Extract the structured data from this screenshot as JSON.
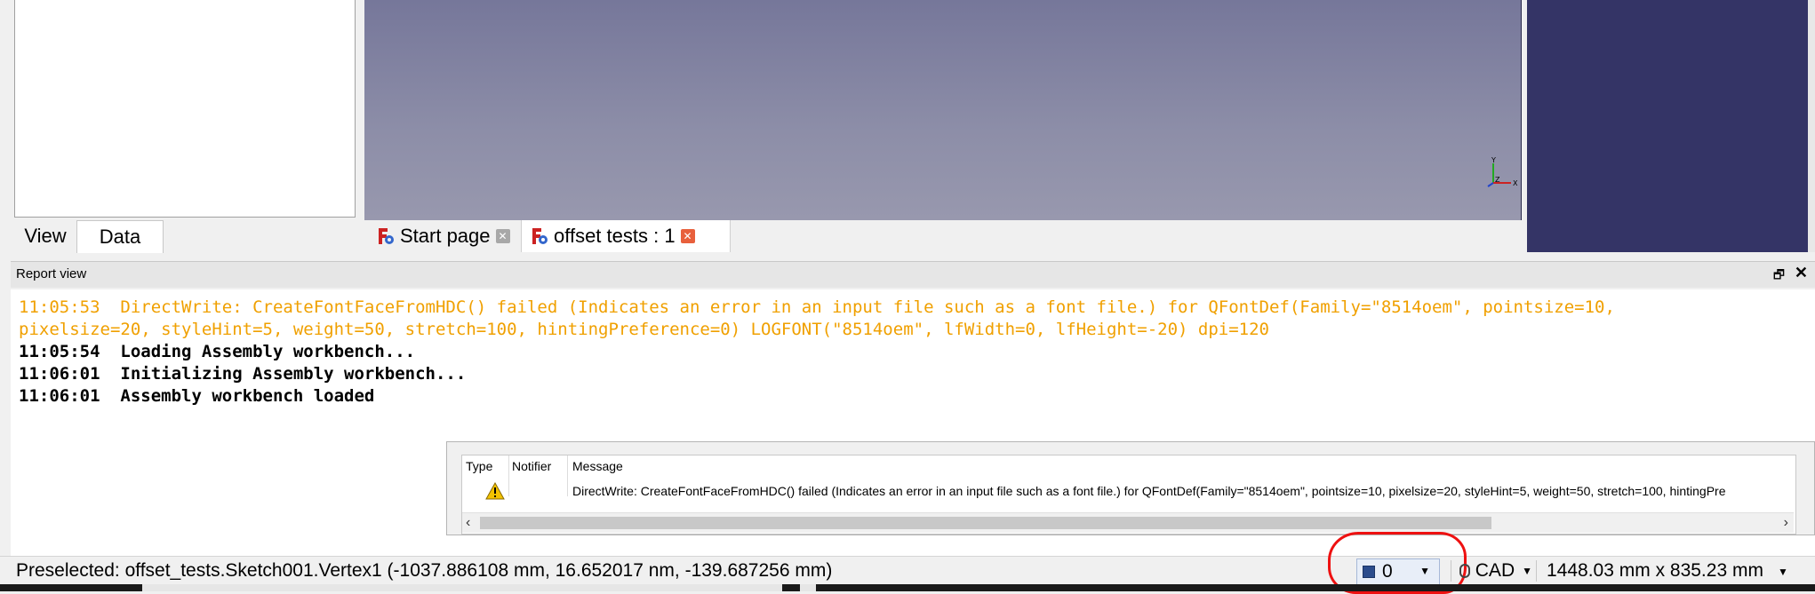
{
  "left_panel": {
    "tabs": [
      {
        "label": "View"
      },
      {
        "label": "Data"
      }
    ]
  },
  "doc_tabs": [
    {
      "label": "Start page"
    },
    {
      "label": "offset tests : 1"
    }
  ],
  "axis": {
    "y": "Y",
    "z": "Z",
    "x": "X"
  },
  "report": {
    "title": "Report view",
    "lines": [
      {
        "text": "11:05:53  DirectWrite: CreateFontFaceFromHDC() failed (Indicates an error in an input file such as a font file.) for QFontDef(Family=\"8514oem\", pointsize=10,",
        "kind": "warn"
      },
      {
        "text": "pixelsize=20, styleHint=5, weight=50, stretch=100, hintingPreference=0) LOGFONT(\"8514oem\", lfWidth=0, lfHeight=-20) dpi=120",
        "kind": "warn"
      },
      {
        "text": "11:05:54  Loading Assembly workbench...",
        "kind": "norm"
      },
      {
        "text": "11:06:01  Initializing Assembly workbench...",
        "kind": "norm"
      },
      {
        "text": "11:06:01  Assembly workbench loaded",
        "kind": "norm"
      }
    ]
  },
  "notifications": {
    "headers": {
      "type": "Type",
      "notifier": "Notifier",
      "message": "Message"
    },
    "rows": [
      {
        "type_icon": "warning-icon",
        "notifier": "",
        "message": "DirectWrite: CreateFontFaceFromHDC() failed (Indicates an error in an input file such as a font file.) for QFontDef(Family=\"8514oem\", pointsize=10, pixelsize=20, styleHint=5, weight=50, stretch=100, hintingPre"
      }
    ]
  },
  "statusbar": {
    "message": "Preselected: offset_tests.Sketch001.Vertex1 (-1037.886108 mm, 16.652017 nm, -139.687256 mm)",
    "notification_count": "0",
    "nav_style": "CAD",
    "dimensions": "1448.03 mm x 835.23 mm"
  },
  "colors": {
    "warning_text": "#f0a000",
    "highlight": "#ee1111",
    "right_panel": "#343466"
  }
}
